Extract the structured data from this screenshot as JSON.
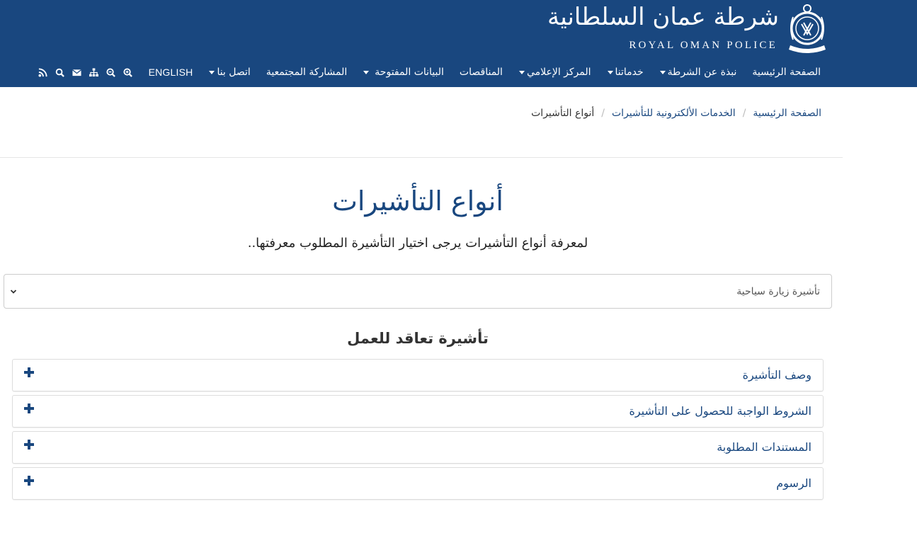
{
  "header": {
    "logo_ar": "شرطة عمان السلطانية",
    "logo_en": "ROYAL OMAN POLICE",
    "bg_color": "#19477f"
  },
  "nav": {
    "items": [
      {
        "label": "الصفحة الرئيسية",
        "dropdown": false
      },
      {
        "label": "نبذة عن الشرطة",
        "dropdown": true
      },
      {
        "label": "خدماتنا",
        "dropdown": true
      },
      {
        "label": "المركز الإعلامي",
        "dropdown": true
      },
      {
        "label": "المناقصات",
        "dropdown": false
      },
      {
        "label": "البيانات المفتوحة",
        "dropdown": true
      },
      {
        "label": "المشاركة المجتمعية",
        "dropdown": false
      },
      {
        "label": "اتصل بنا",
        "dropdown": true
      },
      {
        "label": "ENGLISH",
        "dropdown": false
      }
    ],
    "icons": [
      "zoom-in-icon",
      "zoom-out-icon",
      "sitemap-icon",
      "envelope-icon",
      "search-icon",
      "rss-icon"
    ]
  },
  "breadcrumb": {
    "home": "الصفحة الرئيسية",
    "parent": "الخدمات الألكترونية للتأشيرات",
    "current": "أنواع التأشيرات"
  },
  "main": {
    "title": "أنواع التأشيرات",
    "lead": "لمعرفة أنواع التأشيرات يرجى اختيار التأشيرة المطلوب معرفتها..",
    "select": {
      "value": "تأشيرة زيارة سياحية"
    },
    "section_title": "تأشيرة تعاقد للعمل",
    "accordion": [
      {
        "label": "وصف التأشيرة"
      },
      {
        "label": "الشروط الواجبة للحصول على التأشيرة"
      },
      {
        "label": "المستندات المطلوبة"
      },
      {
        "label": "الرسوم"
      }
    ]
  },
  "colors": {
    "accent": "#19477f",
    "text": "#333333"
  }
}
